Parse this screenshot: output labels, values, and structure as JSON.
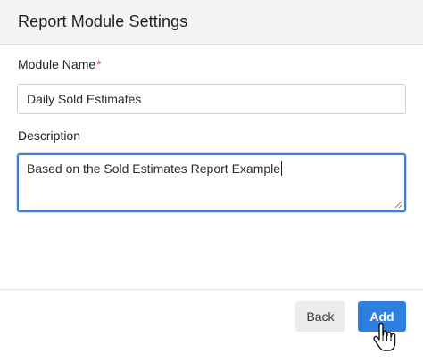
{
  "modal": {
    "title": "Report Module Settings"
  },
  "form": {
    "module_name": {
      "label": "Module Name",
      "required_mark": "*",
      "value": "Daily Sold Estimates"
    },
    "description": {
      "label": "Description",
      "value": "Based on the Sold Estimates Report Example"
    }
  },
  "footer": {
    "back_label": "Back",
    "add_label": "Add"
  },
  "colors": {
    "primary": "#2f7fe0",
    "required": "#d23b3b",
    "focus_border": "#3b82d6"
  },
  "icons": {
    "cursor": "hand-pointer-icon",
    "resize": "resize-grip-icon"
  }
}
